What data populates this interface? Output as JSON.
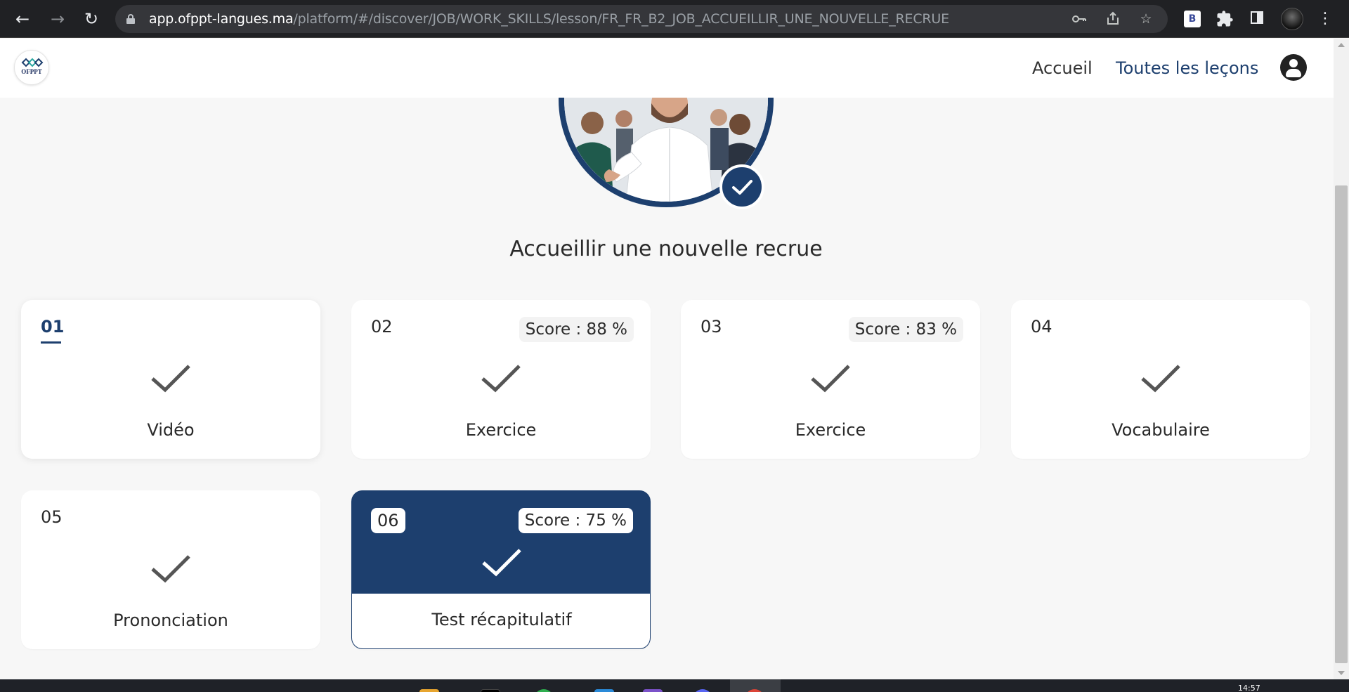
{
  "browser": {
    "url_host": "app.ofppt-langues.ma",
    "url_path": "/platform/#/discover/JOB/WORK_SKILLS/lesson/FR_FR_B2_JOB_ACCUEILLIR_UNE_NOUVELLE_RECRUE",
    "extension_badge": "B"
  },
  "header": {
    "logo_text": "OFPPT",
    "nav": [
      {
        "label": "Accueil",
        "active": false
      },
      {
        "label": "Toutes les leçons",
        "active": true
      }
    ]
  },
  "lesson": {
    "title": "Accueillir une nouvelle recrue",
    "completed": true,
    "steps": [
      {
        "number": "01",
        "label": "Vidéo",
        "score": null,
        "done": true,
        "current": true
      },
      {
        "number": "02",
        "label": "Exercice",
        "score": "Score : 88 %",
        "done": true
      },
      {
        "number": "03",
        "label": "Exercice",
        "score": "Score : 83 %",
        "done": true
      },
      {
        "number": "04",
        "label": "Vocabulaire",
        "score": null,
        "done": true
      },
      {
        "number": "05",
        "label": "Prononciation",
        "score": null,
        "done": true
      },
      {
        "number": "06",
        "label": "Test récapitulatif",
        "score": "Score : 75 %",
        "done": true,
        "selected": true
      }
    ]
  },
  "taskbar": {
    "clock": "14:57"
  },
  "colors": {
    "primary": "#1d3f6e",
    "background": "#f7f7f7",
    "card": "#ffffff",
    "check": "#555555"
  }
}
